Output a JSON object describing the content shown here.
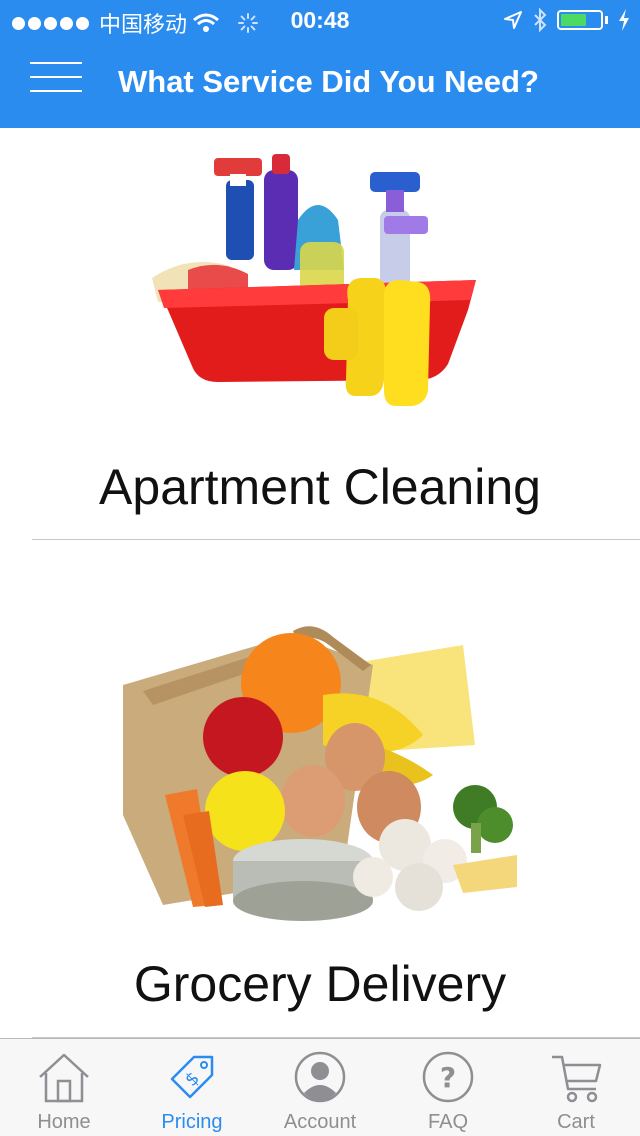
{
  "status_bar": {
    "carrier": "中国移动",
    "time": "00:48"
  },
  "header": {
    "title": "What Service Did You Need?",
    "menu_icon": "hamburger-menu-icon",
    "background_color": "#2b8cf0"
  },
  "services": [
    {
      "label": "Apartment Cleaning",
      "image": "cleaning-supplies-basket"
    },
    {
      "label": "Grocery Delivery",
      "image": "grocery-bag"
    }
  ],
  "tabbar": {
    "active_color": "#2b8cf0",
    "inactive_color": "#8e8e93",
    "items": [
      {
        "label": "Home",
        "icon": "house-icon"
      },
      {
        "label": "Pricing",
        "icon": "price-tag-icon",
        "active": true
      },
      {
        "label": "Account",
        "icon": "user-icon"
      },
      {
        "label": "FAQ",
        "icon": "question-icon"
      },
      {
        "label": "Cart",
        "icon": "cart-icon"
      }
    ]
  }
}
